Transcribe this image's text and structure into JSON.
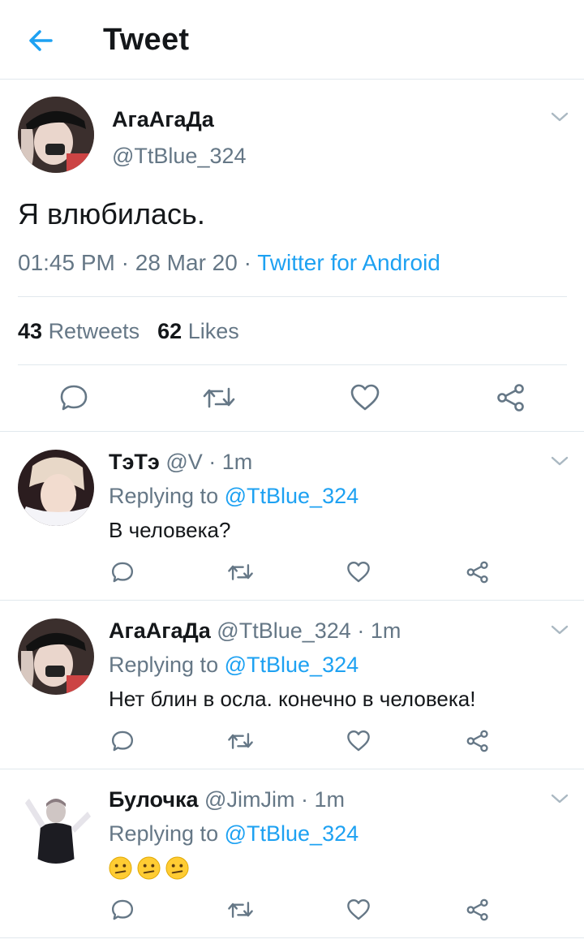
{
  "header": {
    "title": "Tweet",
    "back_icon": "arrow-left-icon",
    "accent": "#1da1f2"
  },
  "main_tweet": {
    "author_name": "АгаАгаДа",
    "author_handle": "@TtBlue_324",
    "text": "Я влюбилась.",
    "time": "01:45 PM",
    "date": "28 Mar 20",
    "separator": " · ",
    "source": "Twitter for Android",
    "retweets_count": "43",
    "retweets_label": "Retweets",
    "likes_count": "62",
    "likes_label": "Likes"
  },
  "replies": [
    {
      "author_name": "ТэТэ",
      "author_handle": "@V",
      "time": "1m",
      "replying_label": "Replying to",
      "replying_to": "@TtBlue_324",
      "text": "В человека?"
    },
    {
      "author_name": "АгаАгаДа",
      "author_handle": "@TtBlue_324",
      "time": "1m",
      "replying_label": "Replying to",
      "replying_to": "@TtBlue_324",
      "text": "Нет блин в осла. конечно в человека!"
    },
    {
      "author_name": "Булочка",
      "author_handle": "@JimJim",
      "time": "1m",
      "replying_label": "Replying to",
      "replying_to": "@TtBlue_324",
      "text": "",
      "emoji": [
        "confused-face-emoji",
        "confused-face-emoji",
        "confused-face-emoji"
      ]
    }
  ],
  "colors": {
    "text": "#14171a",
    "muted": "#657786",
    "link": "#1da1f2",
    "border": "#e1e8ed"
  }
}
